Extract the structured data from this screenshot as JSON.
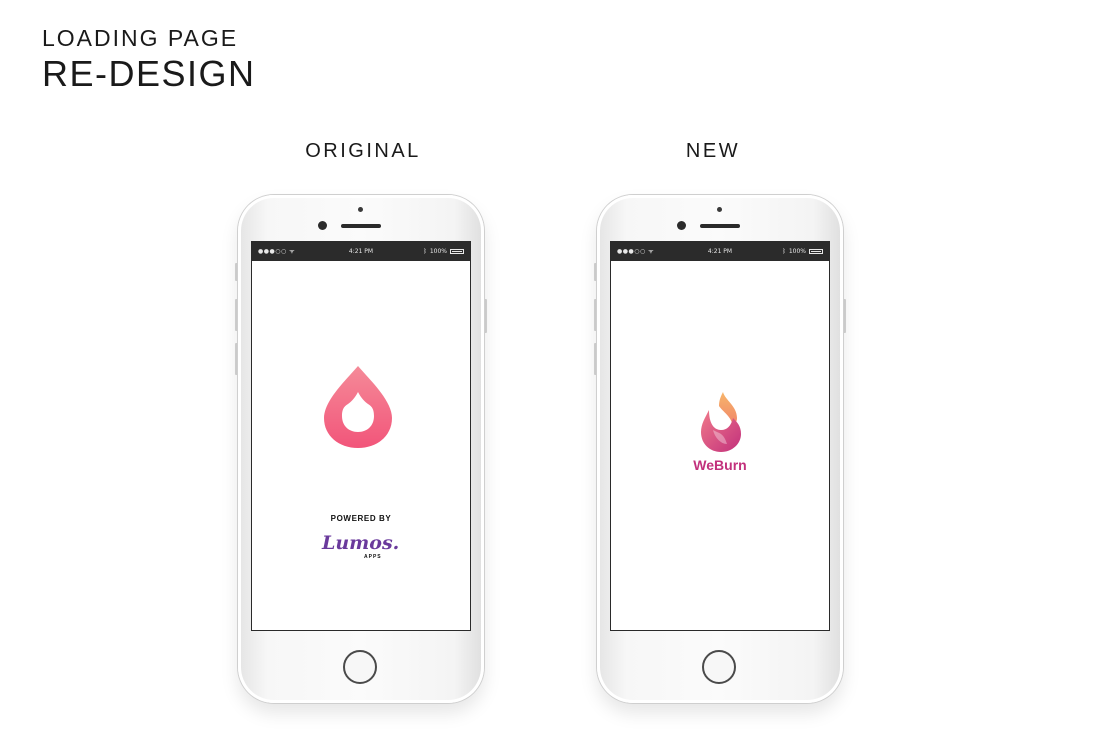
{
  "header": {
    "line1": "LOADING PAGE",
    "line2": "RE-DESIGN"
  },
  "columns": {
    "original_label": "ORIGINAL",
    "new_label": "NEW"
  },
  "status_bar": {
    "signal": "●●●○○ ᯤ",
    "time": "4:21 PM",
    "battery_text": "100%"
  },
  "original_screen": {
    "logo_icon": "flame-drop-icon",
    "powered_by": "POWERED BY",
    "brand_name": "Lumos.",
    "brand_sub": "APPS"
  },
  "new_screen": {
    "logo_icon": "weburn-flame-icon",
    "app_name": "WeBurn"
  },
  "colors": {
    "original_logo_top": "#f27a8c",
    "original_logo_bottom": "#f24f72",
    "weburn_orange": "#f4a15a",
    "weburn_pink": "#c2307c",
    "lumos_purple": "#6a3a9c"
  }
}
